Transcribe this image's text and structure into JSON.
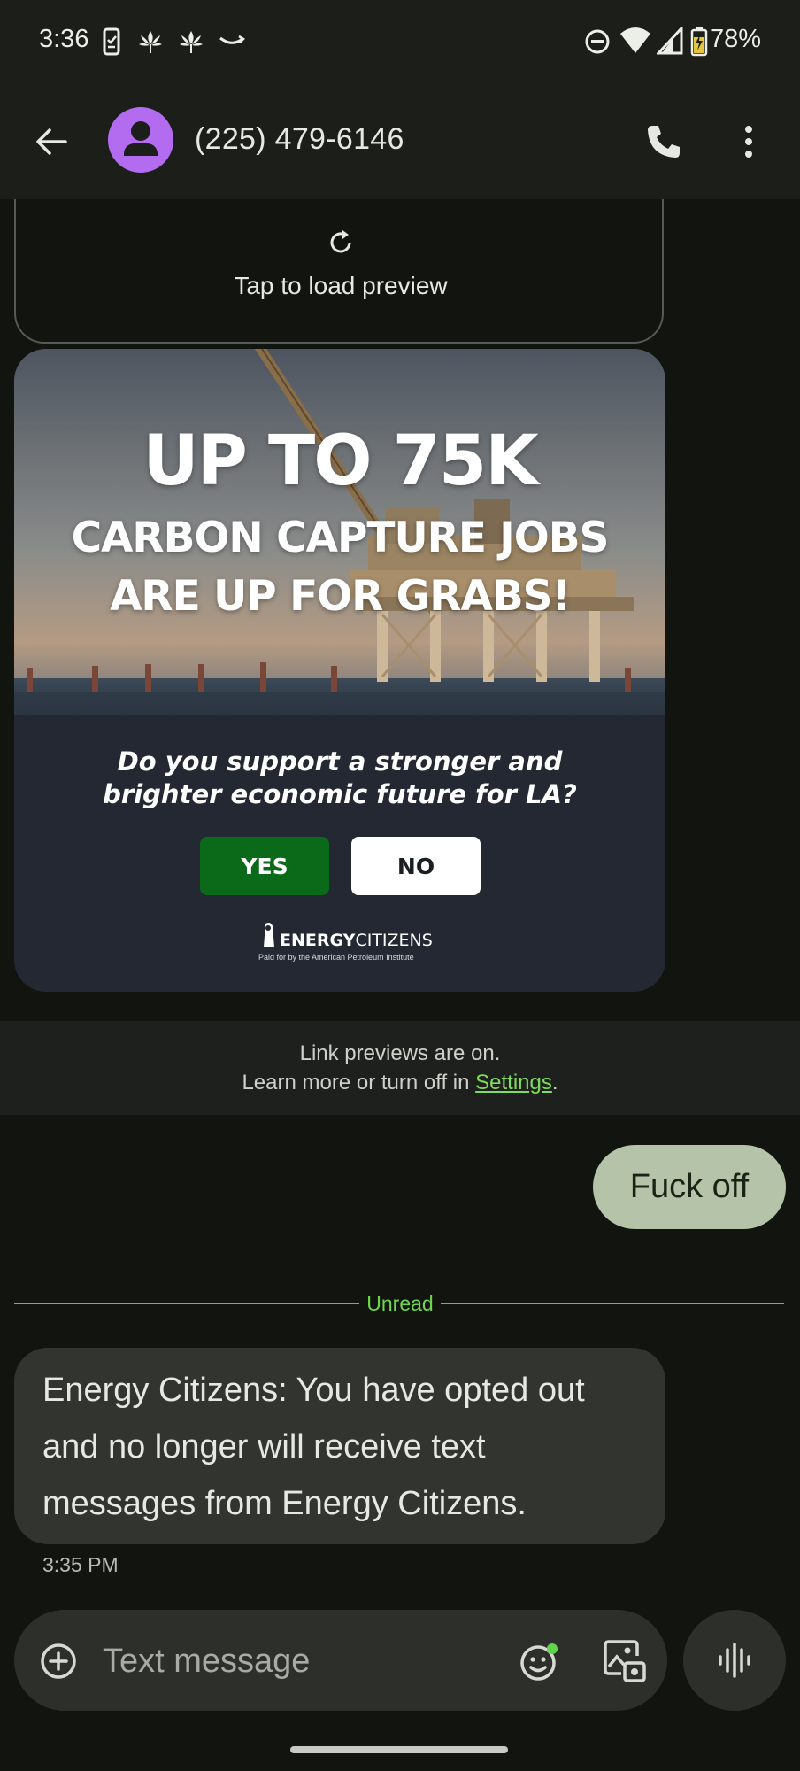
{
  "status_bar": {
    "time": "3:36",
    "battery": "78%"
  },
  "app_bar": {
    "contact": "(225) 479-6146"
  },
  "preview": {
    "tap_to_load": "Tap to load preview"
  },
  "ad": {
    "headline_1": "UP TO 75K",
    "headline_2": "CARBON CAPTURE JOBS",
    "headline_3": "ARE UP FOR GRABS!",
    "question_line_1": "Do you support a stronger and",
    "question_line_2": "brighter economic future for LA?",
    "yes_label": "YES",
    "no_label": "NO",
    "brand_bold": "ENERGY",
    "brand_rest": "CITIZENS",
    "paid_for": "Paid for by the American Petroleum Institute"
  },
  "notice": {
    "line_1": "Link previews are on.",
    "line_2_prefix": "Learn more or turn off in ",
    "settings_link": "Settings",
    "line_2_suffix": "."
  },
  "messages": {
    "outgoing": "Fuck off",
    "unread_label": "Unread",
    "incoming": "Energy Citizens: You have opted out and no longer will receive text messages from Energy Citizens.",
    "incoming_time": "3:35 PM"
  },
  "composer": {
    "placeholder": "Text message"
  },
  "colors": {
    "background": "#12150f",
    "outgoing_bubble": "#b5c4a8",
    "incoming_bubble": "#32352f",
    "accent_green": "#5cc63d",
    "avatar": "#b36cf0",
    "yes_button": "#0b6a19"
  }
}
